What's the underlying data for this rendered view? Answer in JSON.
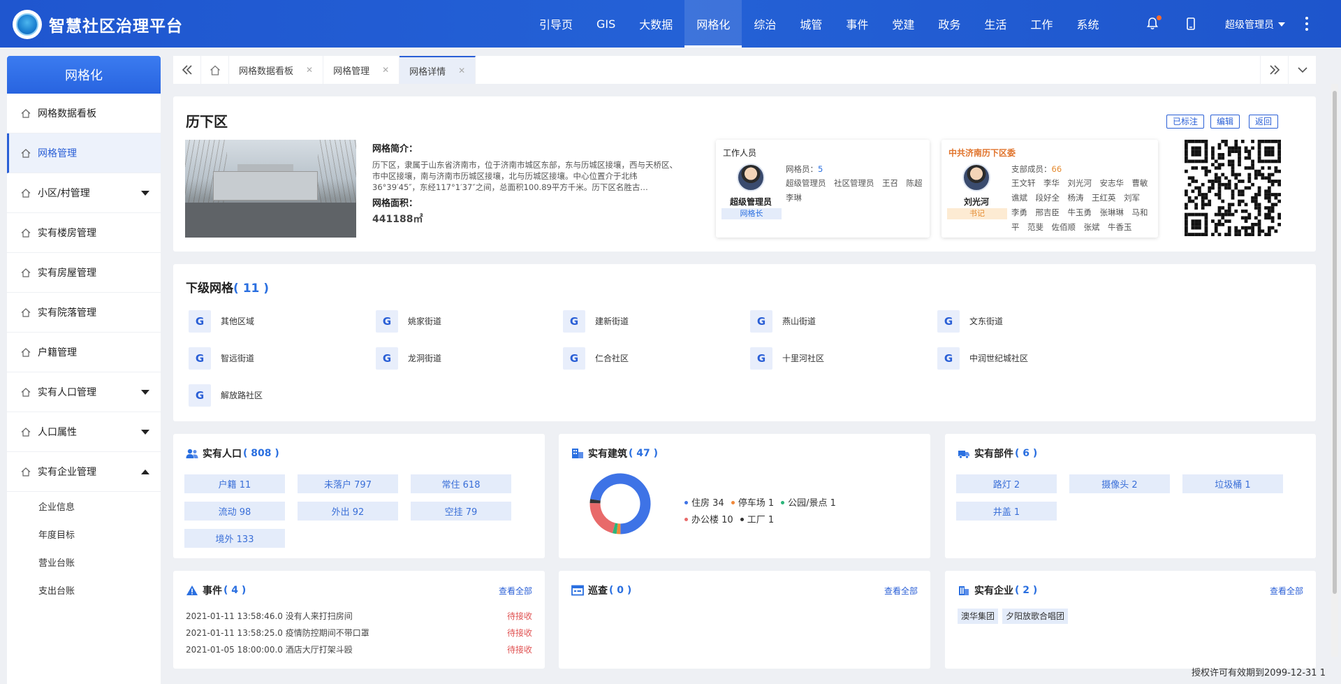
{
  "header": {
    "title": "智慧社区治理平台",
    "nav": [
      "引导页",
      "GIS",
      "大数据",
      "网格化",
      "综治",
      "城管",
      "事件",
      "党建",
      "政务",
      "生活",
      "工作",
      "系统"
    ],
    "active_nav": 3,
    "user": "超级管理员"
  },
  "sidebar": {
    "title": "网格化",
    "items": [
      {
        "label": "网格数据看板",
        "active": false,
        "arrow": ""
      },
      {
        "label": "网格管理",
        "active": true,
        "arrow": ""
      },
      {
        "label": "小区/村管理",
        "active": false,
        "arrow": "down"
      },
      {
        "label": "实有楼房管理",
        "active": false,
        "arrow": ""
      },
      {
        "label": "实有房屋管理",
        "active": false,
        "arrow": ""
      },
      {
        "label": "实有院落管理",
        "active": false,
        "arrow": ""
      },
      {
        "label": "户籍管理",
        "active": false,
        "arrow": ""
      },
      {
        "label": "实有人口管理",
        "active": false,
        "arrow": "down"
      },
      {
        "label": "人口属性",
        "active": false,
        "arrow": "down"
      },
      {
        "label": "实有企业管理",
        "active": false,
        "arrow": "up"
      }
    ],
    "subitems": [
      "企业信息",
      "年度目标",
      "营业台账",
      "支出台账"
    ]
  },
  "tabs": [
    {
      "label": "网格数据看板",
      "active": false
    },
    {
      "label": "网格管理",
      "active": false
    },
    {
      "label": "网格详情",
      "active": true
    }
  ],
  "grid": {
    "name": "历下区",
    "intro_label": "网格简介：",
    "intro": "历下区，隶属于山东省济南市，位于济南市城区东部，东与历城区接壤，西与天桥区、市中区接壤，南与济南市历城区接壤，北与历城区接壤。中心位置介于北纬36°39′45″，东经117°1′37″之间，总面积100.89平方千米。历下区名胜古…",
    "area_label": "网格面积：",
    "area": "441188㎡",
    "buttons": [
      "已标注",
      "编辑",
      "返回"
    ]
  },
  "staff": {
    "title": "工作人员",
    "name": "超级管理员",
    "role": "网格长",
    "count_label": "网格员：",
    "count": "5",
    "members": "超级管理员　社区管理员　王召　陈超　李琳"
  },
  "party": {
    "title": "中共济南历下区委",
    "name": "刘光河",
    "role": "书记",
    "count_label": "支部成员：",
    "count": "66",
    "members": "王文轩　李华　刘光河　安志华　曹敏　谯斌　段好全　杨涛　王红英　刘军　李勇　邢吉臣　牛玉勇　张琳琳　马和平　范斐　佐佰顺　张斌　牛香玉　贾…"
  },
  "subgrids": {
    "title": "下级网格",
    "count": "( 11 )",
    "items": [
      "其他区域",
      "姚家街道",
      "建新街道",
      "燕山街道",
      "文东街道",
      "智远街道",
      "龙洞街道",
      "仁合社区",
      "十里河社区",
      "中润世纪城社区",
      "解放路社区"
    ],
    "badge": "G"
  },
  "population": {
    "title": "实有人口",
    "count": "( 808 )",
    "items": [
      "户籍 11",
      "未落户 797",
      "常住 618",
      "流动 98",
      "外出 92",
      "空挂 79",
      "境外 133"
    ]
  },
  "buildings": {
    "title": "实有建筑",
    "count": "( 47 )",
    "legend": [
      {
        "label": "住房 34",
        "color": "#3e73e6"
      },
      {
        "label": "停车场 1",
        "color": "#f0883a"
      },
      {
        "label": "公园/景点 1",
        "color": "#2bb57a"
      },
      {
        "label": "办公楼 10",
        "color": "#e86a6a"
      },
      {
        "label": "工厂 1",
        "color": "#333333"
      }
    ]
  },
  "chart_data": {
    "type": "pie",
    "categories": [
      "住房",
      "停车场",
      "公园/景点",
      "办公楼",
      "工厂"
    ],
    "values": [
      34,
      1,
      1,
      10,
      1
    ],
    "colors": [
      "#3e73e6",
      "#f0883a",
      "#2bb57a",
      "#e86a6a",
      "#333333"
    ],
    "title": "",
    "donut": true
  },
  "parts": {
    "title": "实有部件",
    "count": "( 6 )",
    "items": [
      "路灯 2",
      "摄像头 2",
      "垃圾桶 1",
      "井盖 1"
    ]
  },
  "events": {
    "title": "事件",
    "count": "( 4 )",
    "view_all": "查看全部",
    "rows": [
      {
        "text": "2021-01-11 13:58:46.0 没有人来打扫房间",
        "status": "待接收"
      },
      {
        "text": "2021-01-11 13:58:25.0 疫情防控期间不带口罩",
        "status": "待接收"
      },
      {
        "text": "2021-01-05 18:00:00.0 酒店大厅打架斗殴",
        "status": "待接收"
      }
    ]
  },
  "patrol": {
    "title": "巡查",
    "count": "( 0 )",
    "view_all": "查看全部"
  },
  "enterprise": {
    "title": "实有企业",
    "count": "( 2 )",
    "view_all": "查看全部",
    "items": [
      "澳华集团",
      "夕阳放歌合唱团"
    ]
  },
  "footer": "授权许可有效期到2099-12-31 1"
}
